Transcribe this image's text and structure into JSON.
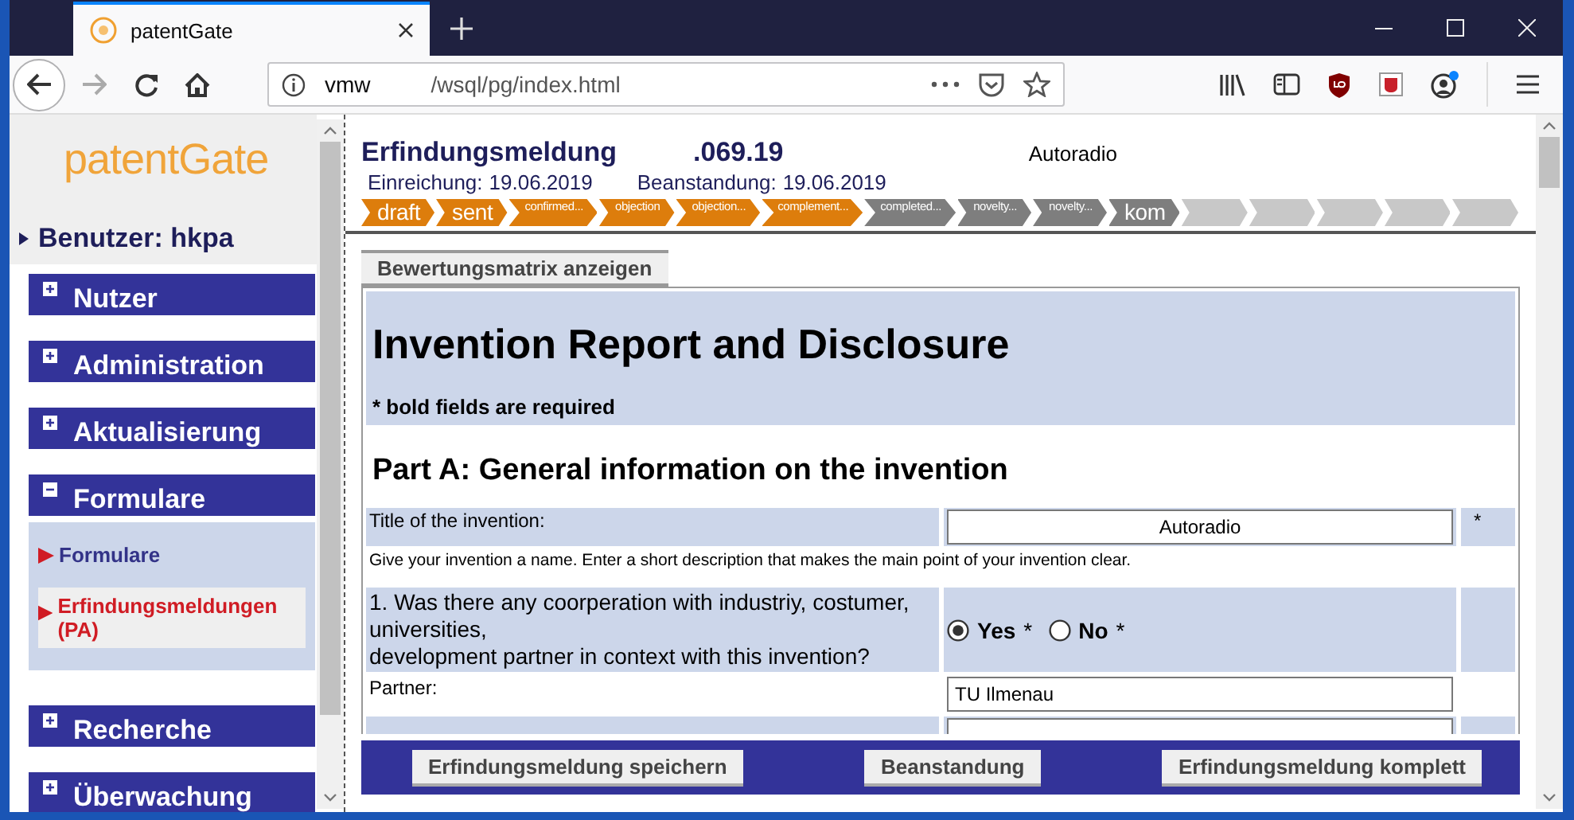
{
  "browser": {
    "tab_title": "patentGate",
    "url_host": "vmw",
    "url_path": "/wsql/pg/index.html"
  },
  "sidebar": {
    "logo": "patentGate",
    "user": "Benutzer: hkpa",
    "menu": [
      {
        "label": "Nutzer",
        "expanded": false
      },
      {
        "label": "Administration",
        "expanded": false
      },
      {
        "label": "Aktualisierung",
        "expanded": false
      },
      {
        "label": "Formulare",
        "expanded": true,
        "children": [
          {
            "label": "Formulare",
            "selected": false
          },
          {
            "label": "Erfindungsmeldungen (PA)",
            "selected": true
          }
        ]
      },
      {
        "label": "Recherche",
        "expanded": false
      },
      {
        "label": "Überwachung",
        "expanded": false
      }
    ]
  },
  "header": {
    "title": "Erfindungsmeldung",
    "number": ".069.19",
    "subject": "Autoradio",
    "dates": [
      {
        "label": "Einreichung:",
        "value": "19.06.2019"
      },
      {
        "label": "Beanstandung:",
        "value": "19.06.2019"
      }
    ]
  },
  "stages": [
    {
      "label": "draft",
      "done": true
    },
    {
      "label": "sent",
      "done": true
    },
    {
      "label": "confirmed...",
      "done": true
    },
    {
      "label": "objection",
      "done": true
    },
    {
      "label": "objection...",
      "done": true
    },
    {
      "label": "complement...",
      "done": true
    },
    {
      "label": "completed...",
      "done": false
    },
    {
      "label": "novelty...",
      "done": false
    },
    {
      "label": "novelty...",
      "done": false
    },
    {
      "label": "kom",
      "done": false
    }
  ],
  "matrix_button": "Bewertungsmatrix anzeigen",
  "form": {
    "title": "Invention Report and Disclosure",
    "note": "* bold fields are required",
    "section": "Part A: General information on the invention",
    "rows": [
      {
        "kind": "field",
        "shaded": true,
        "label": "Title of the invention:",
        "value": "Autoradio",
        "centered": true,
        "marker": "*"
      },
      {
        "kind": "hint",
        "text": "Give your invention a name. Enter a short description that makes the main point of your invention clear."
      },
      {
        "kind": "radio",
        "shaded": true,
        "lines": [
          "1. Was there any coorperation with industriy, costumer, universities,",
          "development partner in context with this invention?"
        ],
        "options": [
          {
            "label": "Yes",
            "marker": "*",
            "selected": true
          },
          {
            "label": "No",
            "marker": "*",
            "selected": false
          }
        ]
      },
      {
        "kind": "field",
        "shaded": false,
        "label": "Partner:",
        "value": "TU Ilmenau",
        "centered": false
      },
      {
        "kind": "partial",
        "shaded": true
      }
    ]
  },
  "actions": [
    "Erfindungsmeldung speichern",
    "Beanstandung",
    "Erfindungsmeldung komplett"
  ]
}
